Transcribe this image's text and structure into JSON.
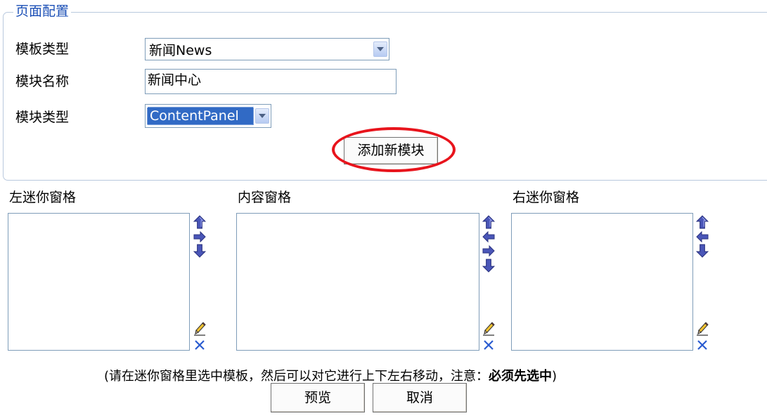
{
  "fieldset": {
    "legend": "页面配置"
  },
  "form": {
    "template_type_label": "模板类型",
    "template_type_value": "新闻News",
    "module_name_label": "模块名称",
    "module_name_value": "新闻中心",
    "module_type_label": "模块类型",
    "module_type_value": "ContentPanel",
    "add_module_button": "添加新模块"
  },
  "panes": {
    "left_title": "左迷你窗格",
    "content_title": "内容窗格",
    "right_title": "右迷你窗格"
  },
  "icons": {
    "move_up": "arrow-up-icon",
    "move_right": "arrow-right-icon",
    "move_left": "arrow-left-icon",
    "move_down": "arrow-down-icon",
    "edit": "pencil-icon",
    "delete": "close-icon"
  },
  "colors": {
    "legend": "#1b4fb6",
    "highlight_ellipse": "#e8141c",
    "arrow": "#4a56b8",
    "selection": "#316ac5"
  },
  "note": {
    "prefix": "(请在迷你窗格里选中模板，然后可以对它进行上下左右移动，注意：",
    "bold": "必须先选中",
    "suffix": ")"
  },
  "buttons": {
    "preview": "预览",
    "cancel": "取消"
  }
}
